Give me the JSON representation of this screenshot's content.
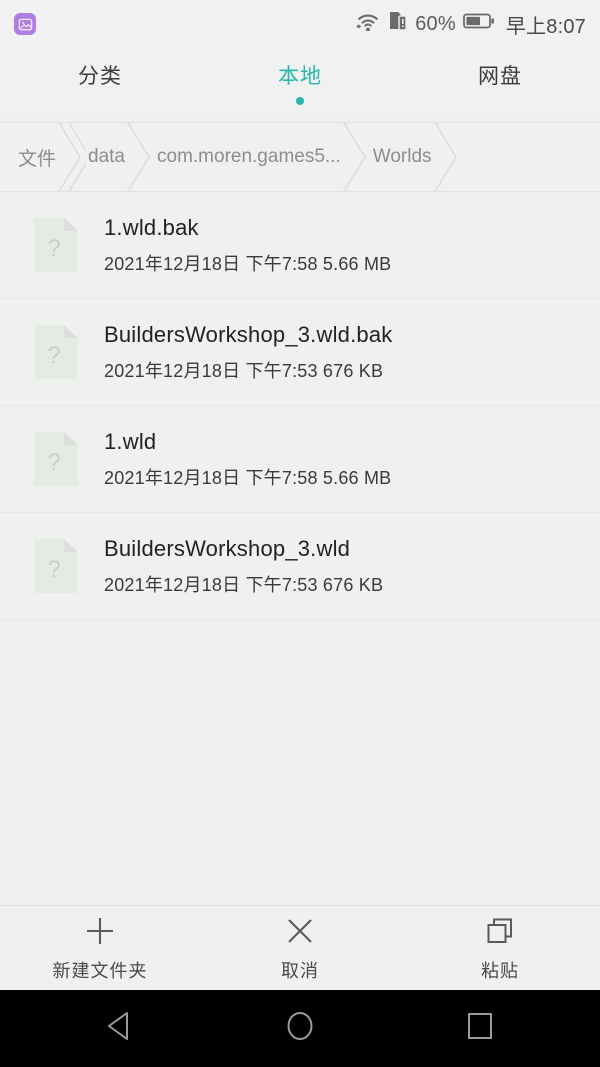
{
  "status_bar": {
    "notification_icon": "gallery-app-icon",
    "wifi_icon": "wifi-icon",
    "sim_icon": "sim-card-alert-icon",
    "battery_percent": "60%",
    "battery_icon": "battery-icon",
    "time": "早上8:07"
  },
  "tabs": [
    {
      "label": "分类",
      "active": false
    },
    {
      "label": "本地",
      "active": true
    },
    {
      "label": "网盘",
      "active": false
    }
  ],
  "breadcrumb": [
    {
      "label": "文件"
    },
    {
      "label": "data"
    },
    {
      "label": "com.moren.games5..."
    },
    {
      "label": "Worlds"
    }
  ],
  "files": [
    {
      "name": "1.wld.bak",
      "meta": "2021年12月18日 下午7:58 5.66 MB",
      "icon": "unknown-file-icon"
    },
    {
      "name": "BuildersWorkshop_3.wld.bak",
      "meta": "2021年12月18日 下午7:53 676 KB",
      "icon": "unknown-file-icon"
    },
    {
      "name": "1.wld",
      "meta": "2021年12月18日 下午7:58 5.66 MB",
      "icon": "unknown-file-icon"
    },
    {
      "name": "BuildersWorkshop_3.wld",
      "meta": "2021年12月18日 下午7:53 676 KB",
      "icon": "unknown-file-icon"
    }
  ],
  "toolbar": [
    {
      "label": "新建文件夹",
      "icon": "plus-icon"
    },
    {
      "label": "取消",
      "icon": "close-icon"
    },
    {
      "label": "粘贴",
      "icon": "paste-icon"
    }
  ],
  "navigation_bar": {
    "back": "back-triangle-icon",
    "home": "home-circle-icon",
    "recents": "recents-square-icon"
  },
  "colors": {
    "accent_teal": "#29b6ae",
    "content_bg": "#eef1ee",
    "chrome_bg": "#f0f0f0",
    "notification_purple": "#b07ee0"
  }
}
